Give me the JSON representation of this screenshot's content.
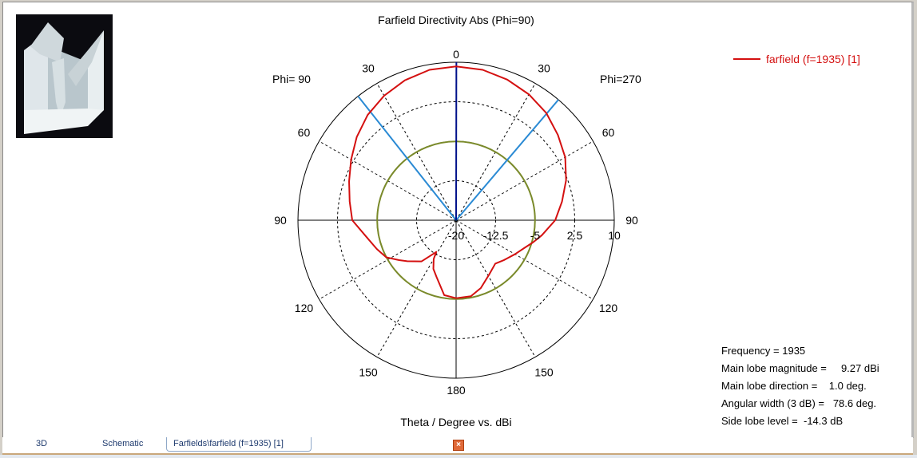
{
  "chart_data": {
    "type": "polar",
    "title": "Farfield Directivity Abs (Phi=90)",
    "xlabel": "Theta / Degree vs. dBi",
    "left_label": "Phi= 90",
    "right_label": "Phi=270",
    "rlim": [
      -20,
      10
    ],
    "radial_ticks": [
      "-20",
      "-12.5",
      "-5",
      "2.5",
      "10"
    ],
    "radial_tick_values": [
      -20,
      -12.5,
      -5,
      2.5,
      10
    ],
    "angle_labels": {
      "top": "0",
      "bottom": "180",
      "left": [
        "30",
        "60",
        "90",
        "120",
        "150"
      ],
      "right": [
        "30",
        "60",
        "90",
        "120",
        "150"
      ]
    },
    "legend": {
      "label": "farfield (f=1935) [1]",
      "placement": "top-right"
    },
    "series": [
      {
        "name": "farfield (f=1935) [1] Phi=90 side",
        "color": "#d41010",
        "theta": [
          0,
          10,
          20,
          30,
          40,
          50,
          60,
          70,
          80,
          90,
          100,
          110,
          118,
          125,
          130,
          140,
          147,
          148,
          150,
          155,
          161,
          171,
          180
        ],
        "dbi": [
          9.2,
          9.0,
          8.3,
          7.3,
          6.1,
          4.6,
          3.0,
          1.6,
          0.5,
          -0.3,
          -2.6,
          -4.0,
          -5.0,
          -6.8,
          -7.9,
          -9.8,
          -12.6,
          -12.9,
          -11.5,
          -9.8,
          -8.6,
          -5.6,
          -5.2
        ]
      },
      {
        "name": "farfield (f=1935) [1] Phi=270 side",
        "color": "#d41010",
        "theta": [
          0,
          10,
          20,
          30,
          40,
          50,
          60,
          70,
          80,
          90,
          100,
          106,
          112,
          120,
          130,
          138,
          149,
          160,
          169,
          180
        ],
        "dbi": [
          9.2,
          9.0,
          8.4,
          7.6,
          6.6,
          5.2,
          3.9,
          2.2,
          0.4,
          -1.2,
          -3.5,
          -4.8,
          -6.0,
          -7.1,
          -8.2,
          -8.9,
          -7.9,
          -6.3,
          -5.3,
          -5.2
        ]
      }
    ],
    "main_lobe_direction_deg": 1.0,
    "beamwidth_edges_deg": [
      -38.3,
      40.3
    ],
    "side_lobe_circle_dbi": -5.03,
    "colors": {
      "curve": "#d41010",
      "beam": "#2a8ad4",
      "mainlobe": "#00108a",
      "sidelobe": "#7a8a2a"
    }
  },
  "info": {
    "frequency": "Frequency = 1935",
    "main_lobe_magnitude": "Main lobe magnitude =     9.27 dBi",
    "main_lobe_direction": "Main lobe direction =    1.0 deg.",
    "angular_width": "Angular width (3 dB) =   78.6 deg.",
    "side_lobe_level": "Side lobe level =  -14.3 dB"
  },
  "tabs": [
    {
      "label": "3D"
    },
    {
      "label": "Schematic"
    },
    {
      "label": "Farfields\\farfield (f=1935) [1]"
    }
  ],
  "close_icon": "close-icon"
}
